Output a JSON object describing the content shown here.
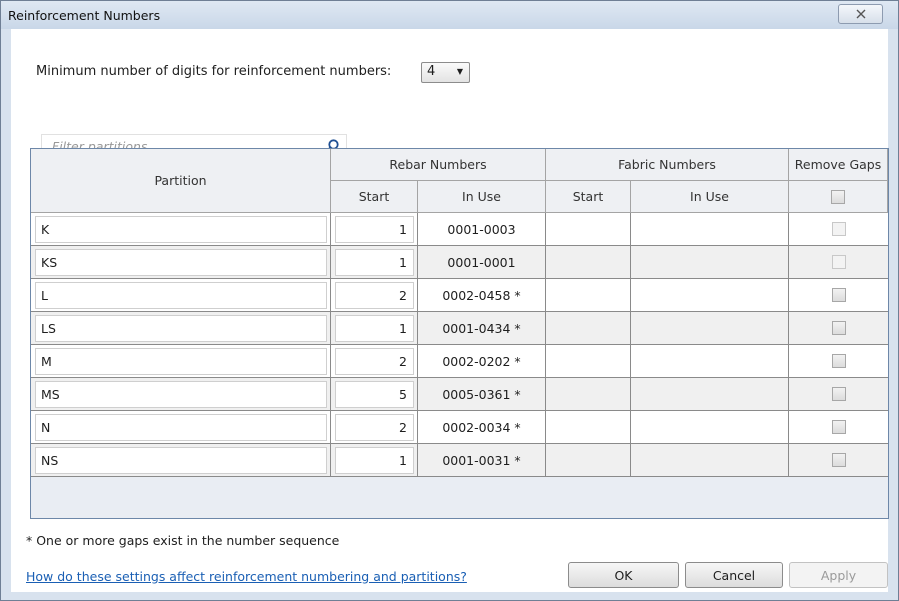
{
  "window": {
    "title": "Reinforcement Numbers",
    "close_icon": "close-icon"
  },
  "digits": {
    "label": "Minimum number of digits for reinforcement numbers:",
    "value": "4"
  },
  "filter": {
    "placeholder": "Filter partitions",
    "icon": "search-icon"
  },
  "table": {
    "headers": {
      "partition": "Partition",
      "rebar_group": "Rebar Numbers",
      "fabric_group": "Fabric Numbers",
      "remove_gaps": "Remove Gaps",
      "rebar_start": "Start",
      "rebar_in_use": "In Use",
      "fabric_start": "Start",
      "fabric_in_use": "In Use"
    },
    "rows": [
      {
        "partition": "K",
        "start": "1",
        "in_use": "0001-0003",
        "gaps_enabled": false
      },
      {
        "partition": "KS",
        "start": "1",
        "in_use": "0001-0001",
        "gaps_enabled": false
      },
      {
        "partition": "L",
        "start": "2",
        "in_use": "0002-0458 *",
        "gaps_enabled": true
      },
      {
        "partition": "LS",
        "start": "1",
        "in_use": "0001-0434 *",
        "gaps_enabled": true
      },
      {
        "partition": "M",
        "start": "2",
        "in_use": "0002-0202 *",
        "gaps_enabled": true
      },
      {
        "partition": "MS",
        "start": "5",
        "in_use": "0005-0361 *",
        "gaps_enabled": true
      },
      {
        "partition": "N",
        "start": "2",
        "in_use": "0002-0034 *",
        "gaps_enabled": true
      },
      {
        "partition": "NS",
        "start": "1",
        "in_use": "0001-0031 *",
        "gaps_enabled": true
      }
    ]
  },
  "footnote": "* One or more gaps exist in the number sequence",
  "help_link": "How do these settings affect reinforcement numbering and partitions?",
  "buttons": {
    "ok": "OK",
    "cancel": "Cancel",
    "apply": "Apply"
  }
}
